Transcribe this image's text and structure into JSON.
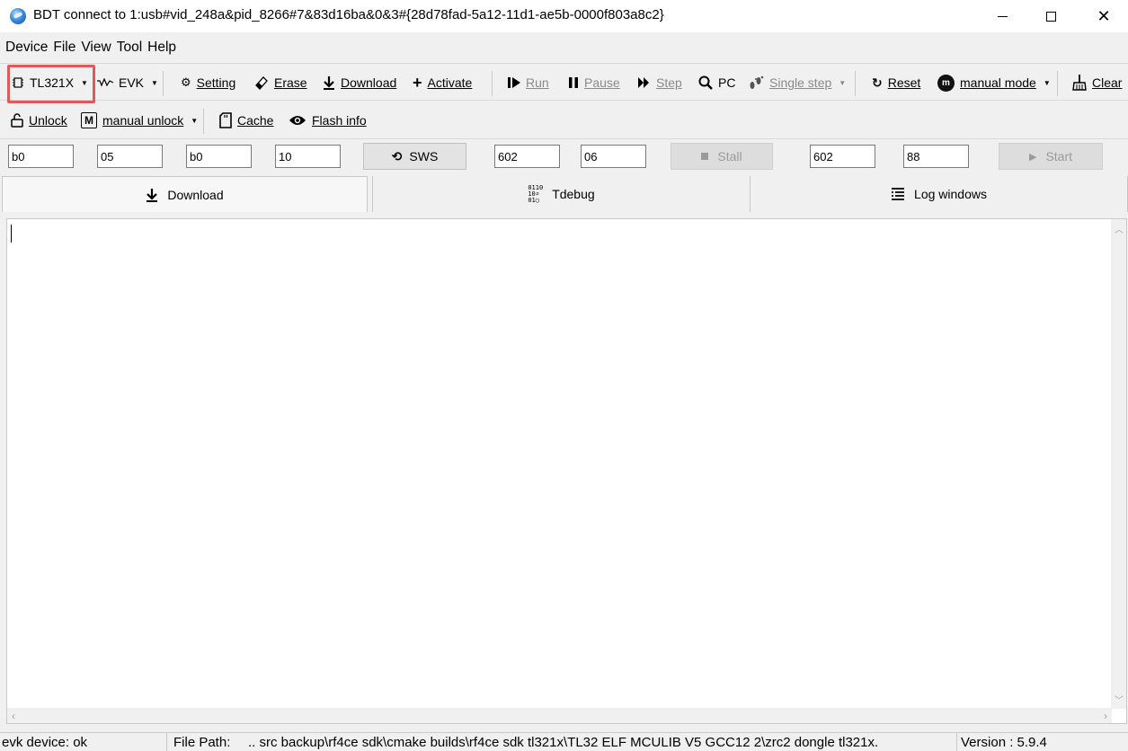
{
  "window": {
    "title": "BDT connect to 1:usb#vid_248a&pid_8266#7&83d16ba&0&3#{28d78fad-5a12-11d1-ae5b-0000f803a8c2}",
    "minimize_icon": "minimize-icon",
    "maximize_icon": "maximize-icon",
    "close_glyph": "✕"
  },
  "menu": [
    "Device",
    "File",
    "View",
    "Tool",
    "Help"
  ],
  "toolbar1": {
    "chip": "TL321X",
    "board": "EVK",
    "setting": "Setting",
    "erase": "Erase",
    "download": "Download",
    "activate": "Activate",
    "run": "Run",
    "pause": "Pause",
    "step": "Step",
    "pc": "PC",
    "single_step": "Single step",
    "reset": "Reset",
    "mode": "manual mode",
    "clear": "Clear"
  },
  "toolbar2": {
    "unlock": "Unlock",
    "manual_unlock": "manual unlock",
    "cache": "Cache",
    "flash_info": "Flash info"
  },
  "inputs": {
    "f1": "b0",
    "f2": "05",
    "f3": "b0",
    "f4": "10",
    "sws": "SWS",
    "f5": "602",
    "f6": "06",
    "stall": "Stall",
    "f7": "602",
    "f8": "88",
    "start": "Start"
  },
  "tabs": {
    "download": "Download",
    "tdebug": "Tdebug",
    "log": "Log windows",
    "active": "Download"
  },
  "status": {
    "device": "evk device: ok",
    "file_path_label": "File Path:",
    "file_path": "..  src backup\\rf4ce sdk\\cmake builds\\rf4ce sdk tl321x\\TL32 ELF MCULIB V5 GCC12 2\\zrc2 dongle tl321x.",
    "version": "Version : 5.9.4"
  },
  "colors": {
    "highlight": "#e05a5a",
    "disabled_text": "#8a8a8a"
  }
}
